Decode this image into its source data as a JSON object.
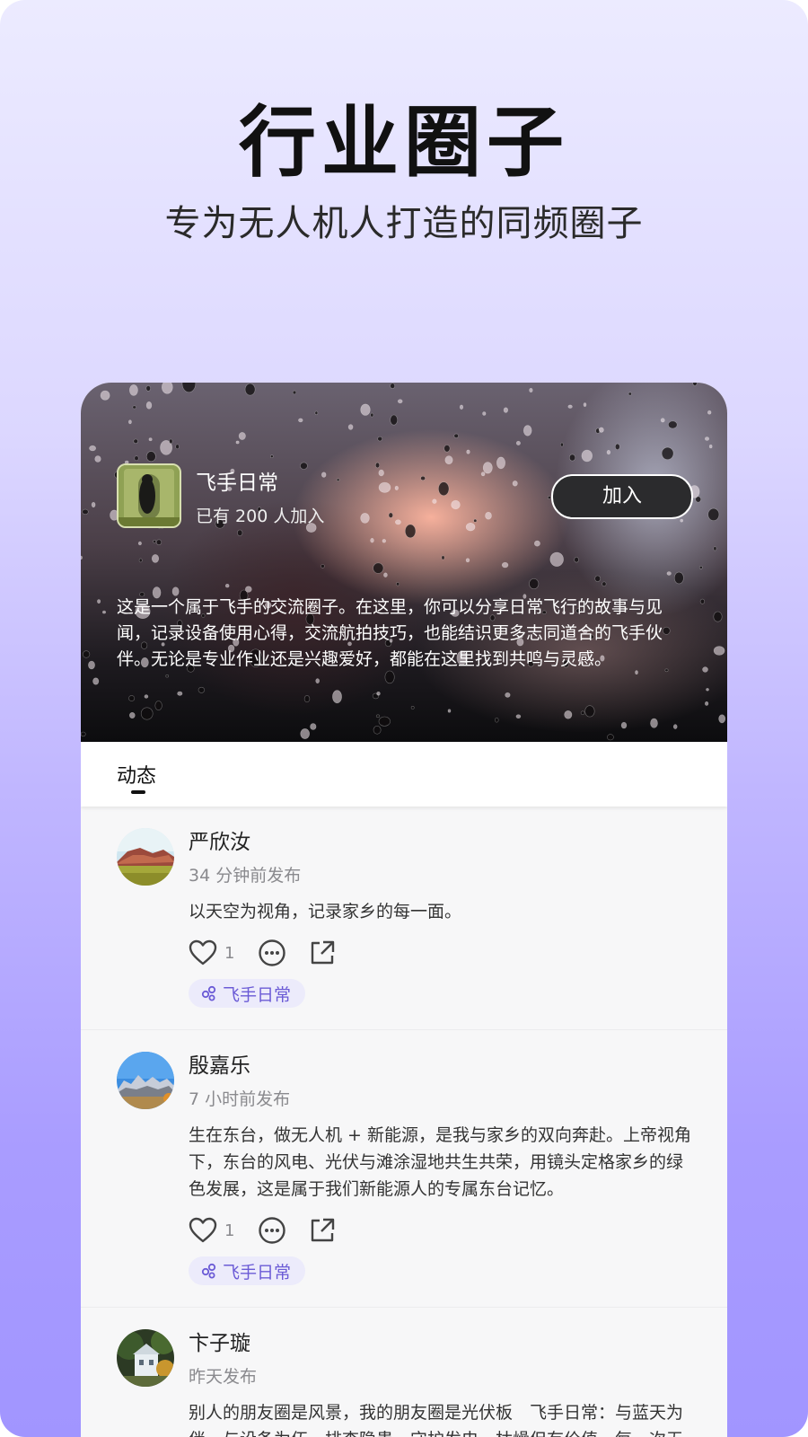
{
  "hero": {
    "title": "行业圈子",
    "subtitle": "专为无人机人打造的同频圈子"
  },
  "circle": {
    "name": "飞手日常",
    "members_text": "已有 200 人加入",
    "join_label": "加入",
    "description": "这是一个属于飞手的交流圈子。在这里，你可以分享日常飞行的故事与见闻，记录设备使用心得，交流航拍技巧，也能结识更多志同道合的飞手伙伴。无论是专业作业还是兴趣爱好，都能在这里找到共鸣与灵感。"
  },
  "tabs": [
    {
      "label": "动态",
      "active": true
    }
  ],
  "posts": [
    {
      "author": "严欣汝",
      "time": "34 分钟前发布",
      "text": "以天空为视角，记录家乡的每一面。",
      "likes": "1",
      "tag": "飞手日常"
    },
    {
      "author": "殷嘉乐",
      "time": "7 小时前发布",
      "text": "生在东台，做无人机 + 新能源，是我与家乡的双向奔赴。上帝视角下，东台的风电、光伏与滩涂湿地共生共荣，用镜头定格家乡的绿色发展，这是属于我们新能源人的专属东台记忆。",
      "likes": "1",
      "tag": "飞手日常"
    },
    {
      "author": "卞子璇",
      "time": "昨天发布",
      "text": "别人的朋友圈是风景，我的朋友圈是光伏板　飞手日常：与蓝天为伴，与设备为伍，排查隐患、守护发电，枯燥但有价值，每一次无人机起降、每一组精准数据，都是对岗位最好的诠释。"
    }
  ],
  "colors": {
    "accent": "#6b5bd6",
    "tag_bg": "#ecebfb",
    "join_bg": "#2b2b2d"
  },
  "icons": [
    "like-heart-icon",
    "more-dots-icon",
    "share-icon",
    "circle-tag-icon"
  ]
}
